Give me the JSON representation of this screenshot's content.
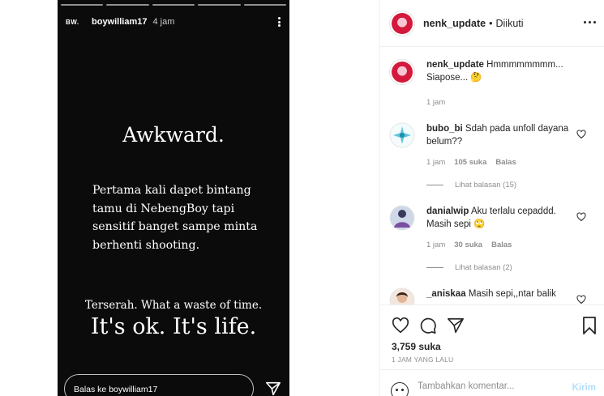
{
  "story": {
    "logo_text": "BW.",
    "username": "boywilliam17",
    "time": "4 jam",
    "title": "Awkward.",
    "body": "Pertama kali dapet bintang tamu di NebengBoy tapi sensitif banget sampe minta berhenti shooting.",
    "line_small": "Terserah. What a waste of time.",
    "line_big": "It's ok. It's life.",
    "reply_placeholder": "Balas ke boywilliam17",
    "progress_segments": 5
  },
  "post": {
    "header": {
      "username": "nenk_update",
      "separator": "•",
      "follow_status": "Diikuti"
    },
    "caption": {
      "username": "nenk_update",
      "text": "Hmmmmmmmm... Siapose... 🤔",
      "time": "1 jam"
    },
    "comments": [
      {
        "username": "bubo_bi",
        "text": "Sdah pada unfoll dayana belum??",
        "time": "1 jam",
        "likes": "105 suka",
        "reply": "Balas",
        "view_replies": "Lihat balasan (15)"
      },
      {
        "username": "danialwip",
        "text": "Aku terlalu cepaddd. Masih sepi 🙄",
        "time": "1 jam",
        "likes": "30 suka",
        "reply": "Balas",
        "view_replies": "Lihat balasan (2)"
      },
      {
        "username": "_aniskaa",
        "text": "Masih sepi,,ntar balik"
      }
    ],
    "likes_count": "3,759 suka",
    "time_ago": "1 JAM YANG LALU",
    "add_comment_placeholder": "Tambahkan komentar...",
    "post_button": "Kirim"
  },
  "colors": {
    "accent": "#b2dffc",
    "story_bg": "#0b0b0b",
    "avatar_brand": "#d4193c"
  }
}
